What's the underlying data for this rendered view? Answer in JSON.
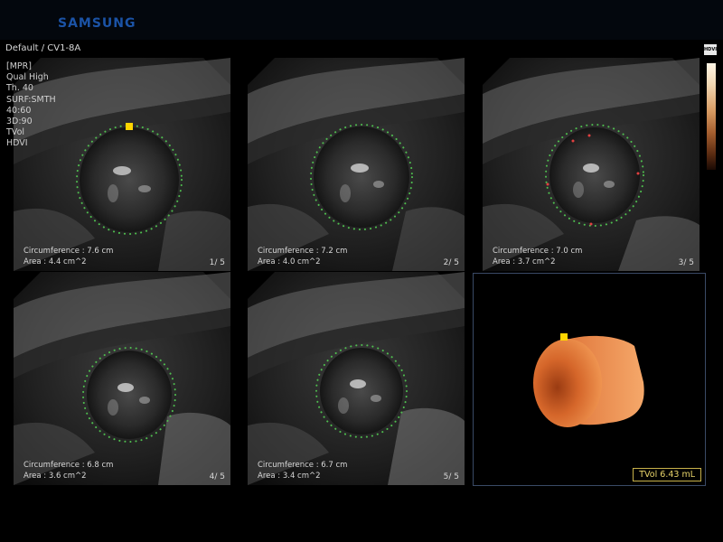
{
  "header": {
    "brand": "SAMSUNG",
    "preset": "Default / CV1-8A"
  },
  "params": [
    "[MPR]",
    "Qual High",
    "Th. 40",
    "SURF:SMTH",
    "40:60",
    "3D:90",
    "TVol",
    "HDVI"
  ],
  "panels": [
    {
      "circ": "Circumference : 7.6 cm",
      "area": "Area : 4.4 cm^2",
      "index": "1/ 5"
    },
    {
      "circ": "Circumference : 7.2 cm",
      "area": "Area : 4.0 cm^2",
      "index": "2/ 5"
    },
    {
      "circ": "Circumference : 7.0 cm",
      "area": "Area : 3.7 cm^2",
      "index": "3/ 5"
    },
    {
      "circ": "Circumference : 6.8 cm",
      "area": "Area : 3.6 cm^2",
      "index": "4/ 5"
    },
    {
      "circ": "Circumference : 6.7 cm",
      "area": "Area : 3.4 cm^2",
      "index": "5/ 5"
    }
  ],
  "render": {
    "tvol": "TVol   6.43  mL"
  },
  "colorbar": {
    "label": "HDVI"
  },
  "colors": {
    "brand": "#1b53a6",
    "contour": "#4fbf4f",
    "marker": "#ffd500",
    "volume": "#e0763a",
    "tvol": "#e8d46a"
  }
}
